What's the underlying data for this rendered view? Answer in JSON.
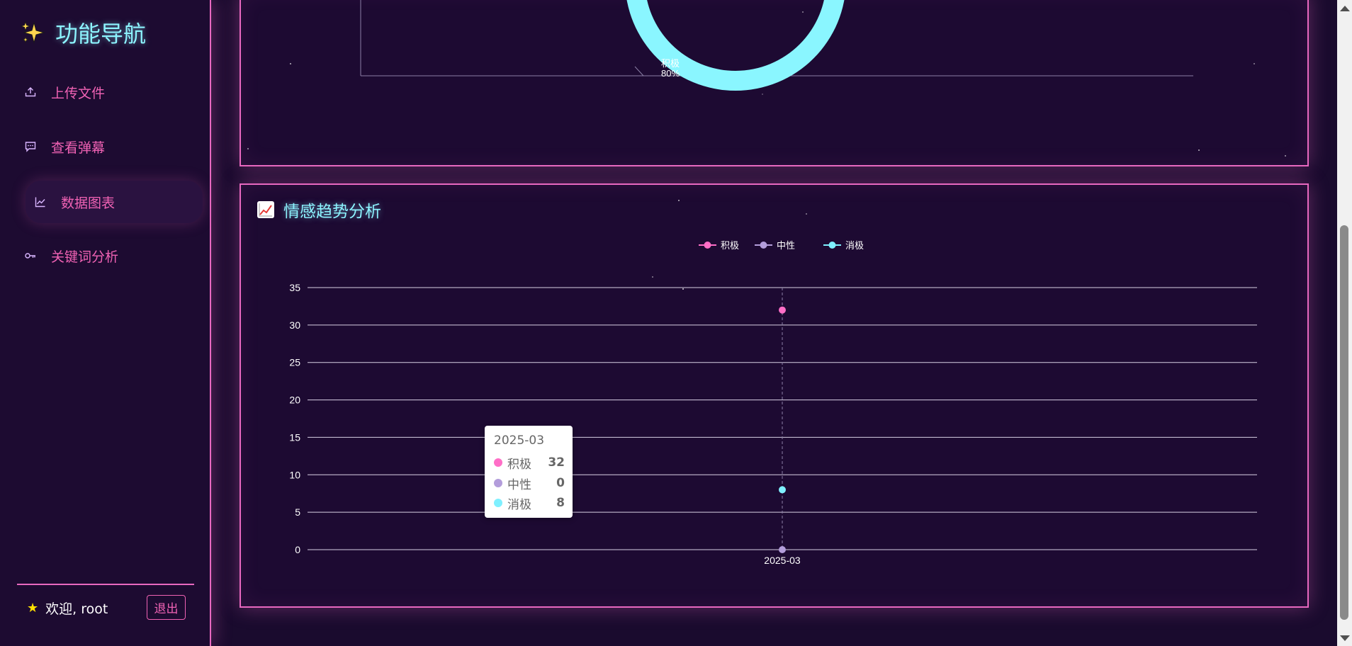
{
  "sidebar": {
    "brand_title": "功能导航",
    "items": [
      {
        "label": "上传文件",
        "icon": "upload-icon"
      },
      {
        "label": "查看弹幕",
        "icon": "comment-icon"
      },
      {
        "label": "数据图表",
        "icon": "line-chart-icon",
        "active": true
      },
      {
        "label": "关键词分析",
        "icon": "key-icon"
      }
    ],
    "welcome": "欢迎, root",
    "logout_label": "退出"
  },
  "donut_panel": {
    "slice_label": "积极",
    "slice_percent": "80%"
  },
  "trend_panel": {
    "title": "情感趋势分析",
    "tooltip": {
      "title": "2025-03",
      "rows": [
        {
          "name": "积极",
          "value": "32",
          "color": "#ff6ec7"
        },
        {
          "name": "中性",
          "value": "0",
          "color": "#b39ddb"
        },
        {
          "name": "消极",
          "value": "8",
          "color": "#7ff0ff"
        }
      ]
    }
  },
  "colors": {
    "accent_pink": "#e868c0",
    "title_cyan": "#8df4ff",
    "background": "#1a0b2e"
  },
  "chart_data": [
    {
      "type": "pie",
      "slices": [
        {
          "label": "积极",
          "value": 80
        }
      ],
      "labels_shown": [
        "积极 80%"
      ]
    },
    {
      "type": "line",
      "title": "情感趋势分析",
      "categories": [
        "2025-03"
      ],
      "series": [
        {
          "name": "积极",
          "values": [
            32
          ],
          "color": "#ff6ec7"
        },
        {
          "name": "中性",
          "values": [
            0
          ],
          "color": "#b39ddb"
        },
        {
          "name": "消极",
          "values": [
            8
          ],
          "color": "#7ff0ff"
        }
      ],
      "ylim": [
        0,
        35
      ],
      "yticks": [
        0,
        5,
        10,
        15,
        20,
        25,
        30,
        35
      ],
      "grid": true,
      "legend_position": "top-center"
    }
  ]
}
